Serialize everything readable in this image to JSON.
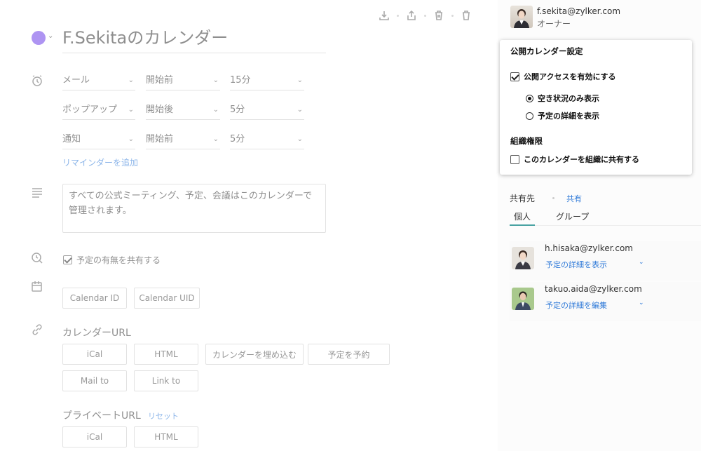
{
  "toolbar": {
    "icons": [
      "download-icon",
      "share-icon",
      "trash-bin-icon",
      "delete-icon"
    ]
  },
  "calendar": {
    "color": "#6c3de8",
    "title": "F.Sekitaのカレンダー"
  },
  "reminders": [
    {
      "method": "メール",
      "when": "開始前",
      "amount": "15分"
    },
    {
      "method": "ポップアップ",
      "when": "開始後",
      "amount": "5分"
    },
    {
      "method": "通知",
      "when": "開始前",
      "amount": "5分"
    }
  ],
  "add_reminder": "リマインダーを追加",
  "description": "すべての公式ミーティング、予定、会議はこのカレンダーで管理されます。",
  "share_availability": {
    "label": "予定の有無を共有する",
    "checked": true
  },
  "id_buttons": {
    "calendar_id": "Calendar ID",
    "calendar_uid": "Calendar UID"
  },
  "calendar_url": {
    "heading": "カレンダーURL",
    "buttons": [
      "iCal",
      "HTML",
      "カレンダーを埋め込む",
      "予定を予約",
      "Mail to",
      "Link to"
    ]
  },
  "private_url": {
    "heading": "プライベートURL",
    "reset": "リセット",
    "buttons": [
      "iCal",
      "HTML"
    ]
  },
  "owner": {
    "email": "f.sekita@zylker.com",
    "role": "オーナー"
  },
  "public_popup": {
    "title": "公開カレンダー設定",
    "enable_public": {
      "label": "公開アクセスを有効にする",
      "checked": true
    },
    "options": [
      {
        "label": "空き状況のみ表示",
        "selected": true
      },
      {
        "label": "予定の詳細を表示",
        "selected": false
      }
    ],
    "org_heading": "組織権限",
    "share_org": {
      "label": "このカレンダーを組織に共有する",
      "checked": false
    }
  },
  "sharing": {
    "heading": "共有先",
    "link": "共有",
    "tabs": [
      "個人",
      "グループ"
    ],
    "active_tab": "個人",
    "users": [
      {
        "email": "h.hisaka@zylker.com",
        "permission": "予定の詳細を表示"
      },
      {
        "email": "takuo.aida@zylker.com",
        "permission": "予定の詳細を編集"
      }
    ]
  }
}
